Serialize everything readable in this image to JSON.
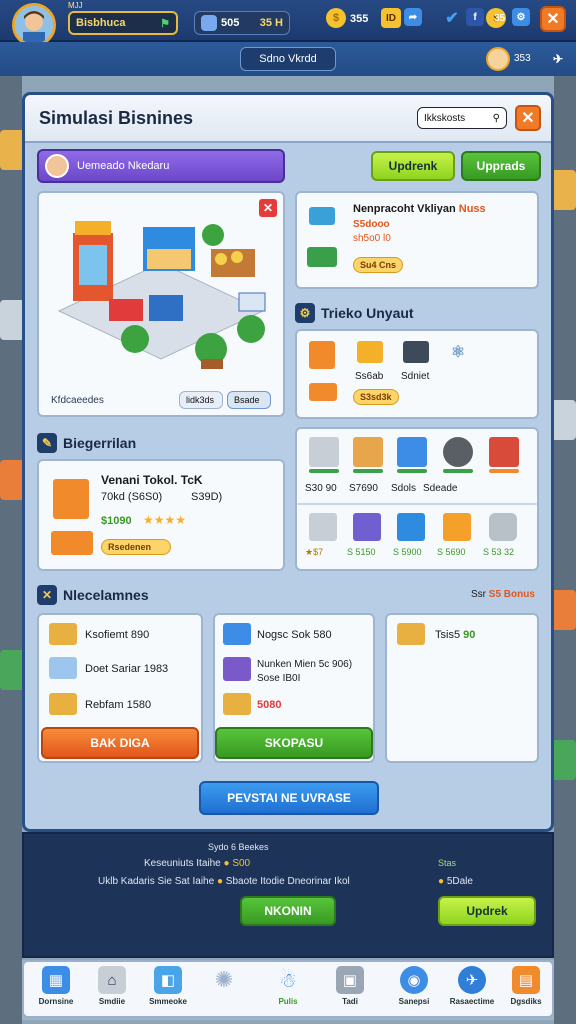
{
  "top": {
    "name_small": "MJJ",
    "level_label": "Bisbhuca",
    "flag_icon": "flag-icon",
    "gem_value": "505",
    "gem_value2": "35 H",
    "coins": "355",
    "bonus": "ID",
    "fb": "35",
    "close": "✕"
  },
  "subbar": {
    "center_label": "Sdno Vkrdd",
    "right_value": "353"
  },
  "panel": {
    "title": "Simulasi Bisnines",
    "search_value": "Ikkskosts",
    "owner_label": "Uemeado Nkedaru",
    "btn_upgrade_a": "Updrenk",
    "btn_upgrade_b": "Upprads",
    "right1": {
      "title": "Nenpracoht Vkliyan",
      "title_accent": "Nuss",
      "line": "S5dooo",
      "line2": "sh5o0 l0",
      "tag": "Su4 Cns"
    },
    "toko_title": "Trieko Unyaut",
    "toko": {
      "val_a": "Ss6ab",
      "val_b": "Sdniet",
      "tag": "S3sd3k"
    },
    "map_labels": {
      "left": "Kfdcaeedes",
      "mid": "lidk3ds",
      "right": "Bsade"
    },
    "bagian_title": "Biegerrilan",
    "bagian": {
      "name": "Venani Tokol. TcK",
      "line": "70kd (S6S0)",
      "line_r": "S39D)",
      "price": "$1090",
      "tag": "Rsedenen"
    },
    "grid_prices_top": [
      "S30 90",
      "S7690",
      "Sdols",
      "Sdeade"
    ],
    "grid_prices_bot": [
      "$7",
      "S 5150",
      "S 5900",
      "S 5690",
      "S 53 32"
    ],
    "nego_title": "Nlecelamnes",
    "nego_right": "Ssr",
    "nego_right_accent": "S5 Bonus",
    "list_a": [
      {
        "label": "Ksofiemt",
        "value": "890"
      },
      {
        "label": "Doet Sariar",
        "value": "1983"
      },
      {
        "label": "Rebfam",
        "value": "1580"
      }
    ],
    "list_b": [
      {
        "label": "Nogsc Sok",
        "value": "580"
      },
      {
        "label": "Nunken Mien",
        "value": "5c 906)",
        "extra": "Sose IB0I"
      },
      {
        "label": "",
        "value": "5080"
      }
    ],
    "list_c": [
      {
        "label": "Tsis5",
        "value": "90"
      }
    ],
    "btn_list_a": "BAK DIGA",
    "btn_list_b": "SKOPASU",
    "btn_center": "PEVSTAI NE UVRASE"
  },
  "bottom": {
    "line1_label": "Sydo",
    "line1_value": "6 Beekes",
    "line2_label": "Keseuniuts Itaihe",
    "line2_value": "S00",
    "line2_right": "Stas",
    "line3_label": "Uklb Kadaris Sie Sat Iaihe",
    "line3_mid": "Sbaote Itodie Dneorinar Ikol",
    "line3_right": "5Dale",
    "btn_left": "NKONIN",
    "btn_right": "Updrek"
  },
  "nav": [
    {
      "label": "Dornsine",
      "icon": "building-icon"
    },
    {
      "label": "Smdiie",
      "icon": "shop-icon"
    },
    {
      "label": "Smmeoke",
      "icon": "box-icon"
    },
    {
      "label": "",
      "icon": "sparkle-icon"
    },
    {
      "label": "Pulis",
      "icon": "character-icon"
    },
    {
      "label": "Tadi",
      "icon": "chest-icon"
    },
    {
      "label": "Sanepsi",
      "icon": "globe-icon"
    },
    {
      "label": "Rasaectime",
      "icon": "blue-globe-icon"
    },
    {
      "label": "Dgsdiks",
      "icon": "package-icon"
    }
  ],
  "colors": {
    "accent_orange": "#e2561c",
    "accent_green": "#379a22",
    "accent_blue": "#1f6fd0",
    "panel": "#b7cde6"
  }
}
